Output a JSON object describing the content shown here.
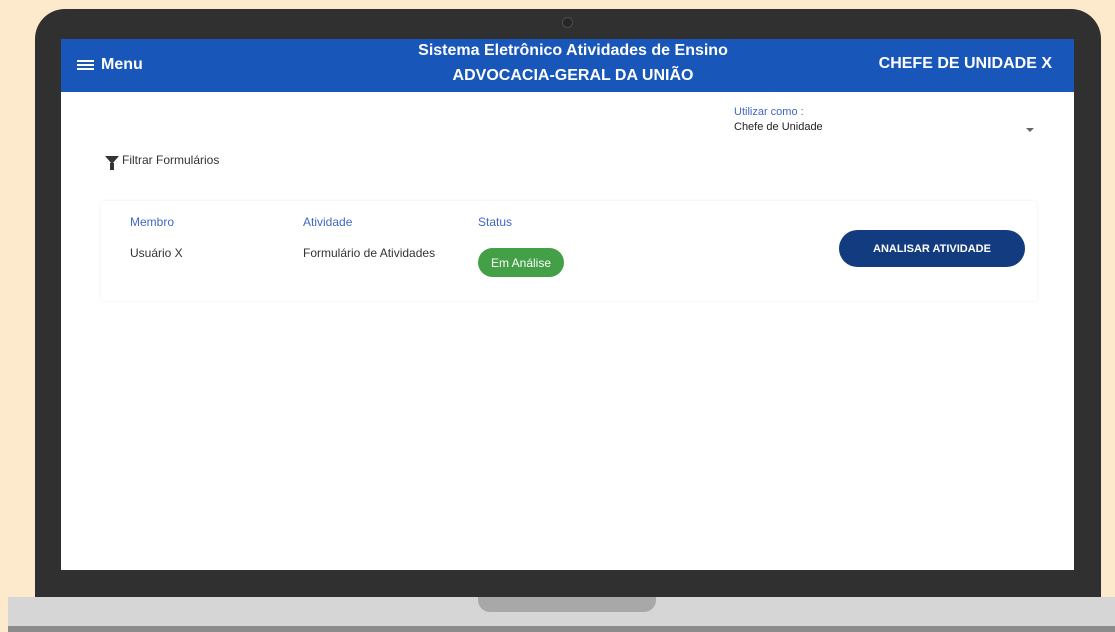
{
  "appbar": {
    "menu_label": "Menu",
    "title_line1": "Sistema Eletrônico Atividades de Ensino",
    "title_line2": "ADVOCACIA-GERAL DA UNIÃO",
    "user_role": "CHEFE DE UNIDADE X",
    "color": "#1857b9"
  },
  "use_as": {
    "label": "Utilizar como :",
    "value": "Chefe de Unidade"
  },
  "filter": {
    "label": "Filtrar Formulários"
  },
  "table": {
    "headers": {
      "member": "Membro",
      "activity": "Atividade",
      "status": "Status"
    },
    "rows": [
      {
        "member": "Usuário X",
        "activity": "Formulário de Atividades",
        "status": "Em Análise",
        "action": "ANALISAR ATIVIDADE"
      }
    ]
  },
  "colors": {
    "status_green": "#43a047",
    "action_navy": "#133b80",
    "background": "#fde9cc"
  },
  "icons": {
    "menu": "hamburger-icon",
    "filter": "filter-icon",
    "select_caret": "caret-down-icon"
  }
}
